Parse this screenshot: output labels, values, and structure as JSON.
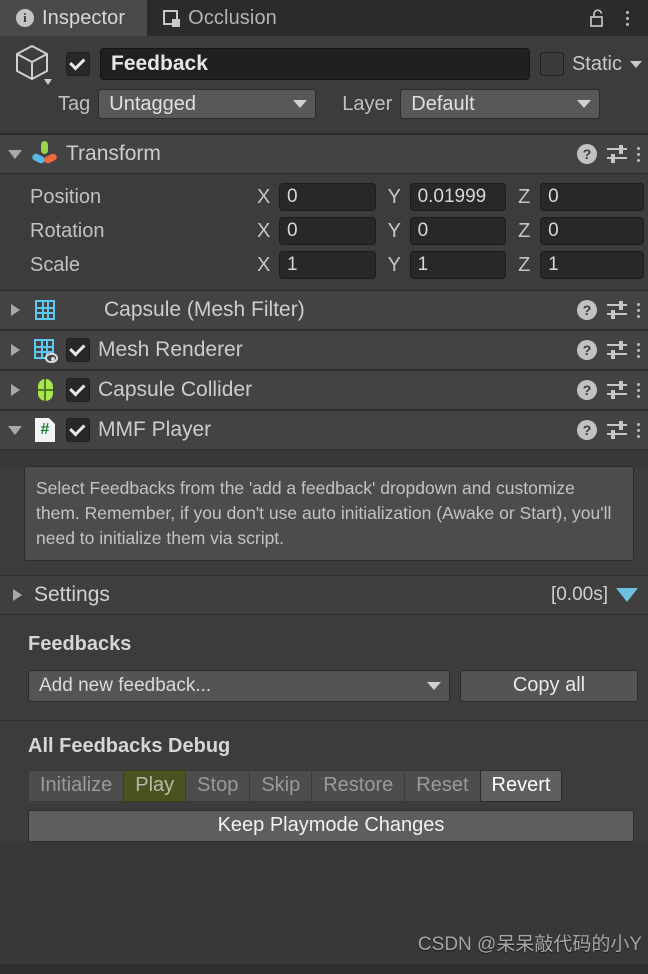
{
  "window": {
    "tabs": [
      {
        "label": "Inspector",
        "icon": "info-icon",
        "active": true
      },
      {
        "label": "Occlusion",
        "icon": "occlusion-icon",
        "active": false
      }
    ],
    "lock_icon": "unlocked-padlock-icon",
    "menu_icon": "kebab-menu-icon"
  },
  "gameobject": {
    "icon": "cube-icon",
    "enabled": true,
    "name": "Feedback",
    "static_label": "Static",
    "static_checked": false,
    "tag_label": "Tag",
    "tag_value": "Untagged",
    "layer_label": "Layer",
    "layer_value": "Default"
  },
  "transform": {
    "title": "Transform",
    "expanded": true,
    "icon": "transform-gizmo-icon",
    "rows": [
      {
        "label": "Position",
        "x": "0",
        "y": "0.01999",
        "z": "0"
      },
      {
        "label": "Rotation",
        "x": "0",
        "y": "0",
        "z": "0"
      },
      {
        "label": "Scale",
        "x": "1",
        "y": "1",
        "z": "1"
      }
    ],
    "axis_x": "X",
    "axis_y": "Y",
    "axis_z": "Z"
  },
  "components": [
    {
      "title": "Capsule (Mesh Filter)",
      "icon": "mesh-filter-icon",
      "has_checkbox": false,
      "checked": false,
      "expanded": false
    },
    {
      "title": "Mesh Renderer",
      "icon": "mesh-renderer-icon",
      "has_checkbox": true,
      "checked": true,
      "expanded": false
    },
    {
      "title": "Capsule Collider",
      "icon": "capsule-collider-icon",
      "has_checkbox": true,
      "checked": true,
      "expanded": false
    },
    {
      "title": "MMF Player",
      "icon": "script-icon",
      "has_checkbox": true,
      "checked": true,
      "expanded": true
    }
  ],
  "mmf_player": {
    "help_text": "Select Feedbacks from the 'add a feedback' dropdown and customize them. Remember, if you don't use auto initialization (Awake or Start), you'll need to initialize them via script.",
    "settings_label": "Settings",
    "settings_timer": "[0.00s]",
    "settings_expanded": false,
    "feedbacks_title": "Feedbacks",
    "add_feedback_placeholder": "Add new feedback...",
    "copy_all_label": "Copy all",
    "debug_title": "All Feedbacks Debug",
    "debug_buttons": [
      {
        "label": "Initialize",
        "state": "normal"
      },
      {
        "label": "Play",
        "state": "active"
      },
      {
        "label": "Stop",
        "state": "normal"
      },
      {
        "label": "Skip",
        "state": "normal"
      },
      {
        "label": "Restore",
        "state": "normal"
      },
      {
        "label": "Reset",
        "state": "normal"
      },
      {
        "label": "Revert",
        "state": "highlighted"
      }
    ],
    "keep_playmode_label": "Keep Playmode Changes"
  },
  "watermark": "CSDN @呆呆敲代码的小Y",
  "colors": {
    "background": "#383838",
    "panel": "#3c3c3c",
    "header": "#434343",
    "accent_blue": "#6ec0e3",
    "play_olive": "#4a5220",
    "icon_blue": "#5ec8f0",
    "icon_green": "#a9e64e"
  }
}
